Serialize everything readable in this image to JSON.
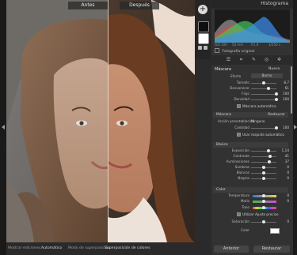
{
  "canvas": {
    "before_label": "Antes",
    "after_label": "Después"
  },
  "panel": {
    "title": "Histograma",
    "histogram_readouts": [
      "ISO 100",
      "50 mm",
      "f/1.8",
      "1/250 s"
    ],
    "original_photo_label": "Fotografía original",
    "mask_section": {
      "left_label": "Máscara",
      "right_label": "Nuevo",
      "effect_label": "Efecto",
      "effect_value": "Borrar",
      "rows": [
        {
          "label": "Tamaño",
          "value": "8,7"
        },
        {
          "label": "Desvanecer",
          "value": "61"
        },
        {
          "label": "Flujo",
          "value": "100"
        },
        {
          "label": "Densidad",
          "value": "100"
        }
      ],
      "auto_mask_label": "Máscara automática"
    },
    "range_section": {
      "left_label": "Máscara",
      "right_label": "Restaurar",
      "range_label": "Acción preestablecida",
      "range_value": "Ninguno",
      "amount_label": "Cantidad",
      "amount_value": "100",
      "checkbox_label": "Usar reajuste automático"
    },
    "basic_section": {
      "title": "Básico",
      "rows": [
        {
          "label": "Exposición",
          "value": "1,14"
        },
        {
          "label": "Contraste",
          "value": "41"
        },
        {
          "label": "Iluminaciones",
          "value": "37"
        },
        {
          "label": "Sombras",
          "value": "0"
        },
        {
          "label": "Blancos",
          "value": "0"
        },
        {
          "label": "Negros",
          "value": "0"
        }
      ]
    },
    "color_section": {
      "title": "Color",
      "rows": [
        {
          "label": "Temperatura",
          "value": "0"
        },
        {
          "label": "Matiz",
          "value": "0"
        }
      ],
      "hue_label": "Tono",
      "hue_checkbox_label": "Utilizar Ajuste preciso",
      "saturation_label": "Saturación",
      "saturation_value": "0",
      "color_label": "Color"
    },
    "buttons": {
      "previous": "Anterior",
      "reset": "Restaurar"
    }
  },
  "statusbar": {
    "show_pins_label": "Mostrar ediciones:",
    "show_pins_value": "Automático",
    "overlay_mode_label": "Modo de superposición:",
    "overlay_mode_value": "Superposición de colores"
  },
  "colors": {
    "panel_bg": "#323232",
    "canvas_bg": "#2b2b2b",
    "histogram_red": "#e04646",
    "histogram_green": "#43c35c",
    "histogram_blue": "#3d8ff0"
  }
}
